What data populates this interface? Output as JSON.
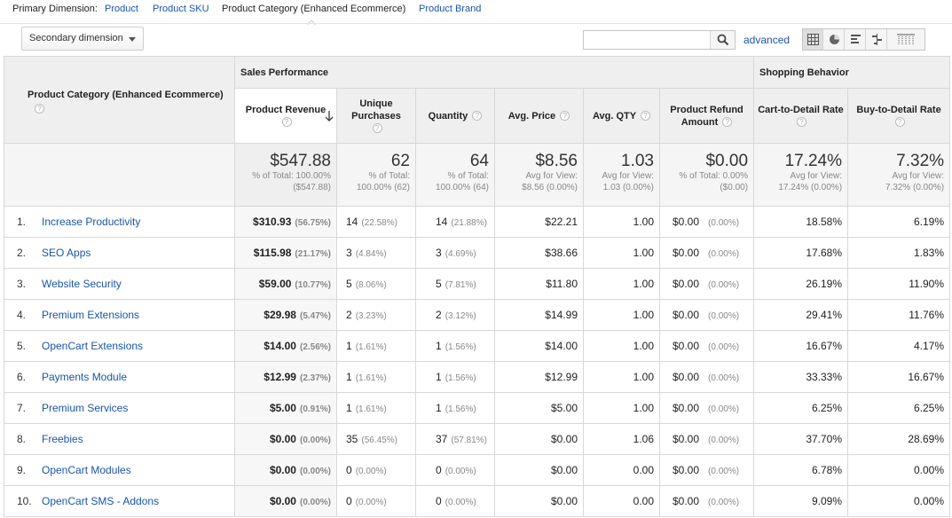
{
  "primary_dimension": {
    "label": "Primary Dimension:",
    "options": [
      "Product",
      "Product SKU",
      "Product Category (Enhanced Ecommerce)",
      "Product Brand"
    ],
    "active_index": 2
  },
  "secondary_dimension": {
    "label": "Secondary dimension"
  },
  "search": {
    "value": "",
    "placeholder": ""
  },
  "advanced_label": "advanced",
  "view_icons": [
    "table-view-icon",
    "pie-view-icon",
    "performance-view-icon",
    "comparison-view-icon",
    "pivot-view-icon"
  ],
  "colors": {
    "link": "#1a55a8",
    "header_bg": "#efefef",
    "border": "#d8d8d8"
  },
  "table": {
    "dimension_header": "Product Category (Enhanced Ecommerce)",
    "groups": {
      "sales": "Sales Performance",
      "shopping": "Shopping Behavior"
    },
    "columns": [
      {
        "label": "Product Revenue",
        "sorted": true
      },
      {
        "label": "Unique Purchases"
      },
      {
        "label": "Quantity"
      },
      {
        "label": "Avg. Price"
      },
      {
        "label": "Avg. QTY"
      },
      {
        "label": "Product Refund Amount"
      },
      {
        "label": "Cart-to-Detail Rate"
      },
      {
        "label": "Buy-to-Detail Rate"
      }
    ],
    "totals": [
      {
        "value": "$547.88",
        "sub1": "% of Total: 100.00%",
        "sub2": "($547.88)"
      },
      {
        "value": "62",
        "sub1": "% of Total:",
        "sub2": "100.00% (62)"
      },
      {
        "value": "64",
        "sub1": "% of Total:",
        "sub2": "100.00% (64)"
      },
      {
        "value": "$8.56",
        "sub1": "Avg for View:",
        "sub2": "$8.56 (0.00%)"
      },
      {
        "value": "1.03",
        "sub1": "Avg for View:",
        "sub2": "1.03 (0.00%)"
      },
      {
        "value": "$0.00",
        "sub1": "% of Total: 0.00%",
        "sub2": "($0.00)"
      },
      {
        "value": "17.24%",
        "sub1": "Avg for View:",
        "sub2": "17.24% (0.00%)"
      },
      {
        "value": "7.32%",
        "sub1": "Avg for View:",
        "sub2": "7.32% (0.00%)"
      }
    ],
    "rows": [
      {
        "idx": "1.",
        "name": "Increase Productivity",
        "revenue": "$310.93",
        "revenue_pct": "(56.75%)",
        "unique": "14",
        "unique_pct": "(22.58%)",
        "qty": "14",
        "qty_pct": "(21.88%)",
        "avg_price": "$22.21",
        "avg_qty": "1.00",
        "refund": "$0.00",
        "refund_pct": "(0.00%)",
        "cart": "18.58%",
        "buy": "6.19%"
      },
      {
        "idx": "2.",
        "name": "SEO Apps",
        "revenue": "$115.98",
        "revenue_pct": "(21.17%)",
        "unique": "3",
        "unique_pct": "(4.84%)",
        "qty": "3",
        "qty_pct": "(4.69%)",
        "avg_price": "$38.66",
        "avg_qty": "1.00",
        "refund": "$0.00",
        "refund_pct": "(0.00%)",
        "cart": "17.68%",
        "buy": "1.83%"
      },
      {
        "idx": "3.",
        "name": "Website Security",
        "revenue": "$59.00",
        "revenue_pct": "(10.77%)",
        "unique": "5",
        "unique_pct": "(8.06%)",
        "qty": "5",
        "qty_pct": "(7.81%)",
        "avg_price": "$11.80",
        "avg_qty": "1.00",
        "refund": "$0.00",
        "refund_pct": "(0.00%)",
        "cart": "26.19%",
        "buy": "11.90%"
      },
      {
        "idx": "4.",
        "name": "Premium Extensions",
        "revenue": "$29.98",
        "revenue_pct": "(5.47%)",
        "unique": "2",
        "unique_pct": "(3.23%)",
        "qty": "2",
        "qty_pct": "(3.12%)",
        "avg_price": "$14.99",
        "avg_qty": "1.00",
        "refund": "$0.00",
        "refund_pct": "(0.00%)",
        "cart": "29.41%",
        "buy": "11.76%"
      },
      {
        "idx": "5.",
        "name": "OpenCart Extensions",
        "revenue": "$14.00",
        "revenue_pct": "(2.56%)",
        "unique": "1",
        "unique_pct": "(1.61%)",
        "qty": "1",
        "qty_pct": "(1.56%)",
        "avg_price": "$14.00",
        "avg_qty": "1.00",
        "refund": "$0.00",
        "refund_pct": "(0.00%)",
        "cart": "16.67%",
        "buy": "4.17%"
      },
      {
        "idx": "6.",
        "name": "Payments Module",
        "revenue": "$12.99",
        "revenue_pct": "(2.37%)",
        "unique": "1",
        "unique_pct": "(1.61%)",
        "qty": "1",
        "qty_pct": "(1.56%)",
        "avg_price": "$12.99",
        "avg_qty": "1.00",
        "refund": "$0.00",
        "refund_pct": "(0.00%)",
        "cart": "33.33%",
        "buy": "16.67%"
      },
      {
        "idx": "7.",
        "name": "Premium Services",
        "revenue": "$5.00",
        "revenue_pct": "(0.91%)",
        "unique": "1",
        "unique_pct": "(1.61%)",
        "qty": "1",
        "qty_pct": "(1.56%)",
        "avg_price": "$5.00",
        "avg_qty": "1.00",
        "refund": "$0.00",
        "refund_pct": "(0.00%)",
        "cart": "6.25%",
        "buy": "6.25%"
      },
      {
        "idx": "8.",
        "name": "Freebies",
        "revenue": "$0.00",
        "revenue_pct": "(0.00%)",
        "unique": "35",
        "unique_pct": "(56.45%)",
        "qty": "37",
        "qty_pct": "(57.81%)",
        "avg_price": "$0.00",
        "avg_qty": "1.06",
        "refund": "$0.00",
        "refund_pct": "(0.00%)",
        "cart": "37.70%",
        "buy": "28.69%"
      },
      {
        "idx": "9.",
        "name": "OpenCart Modules",
        "revenue": "$0.00",
        "revenue_pct": "(0.00%)",
        "unique": "0",
        "unique_pct": "(0.00%)",
        "qty": "0",
        "qty_pct": "(0.00%)",
        "avg_price": "$0.00",
        "avg_qty": "0.00",
        "refund": "$0.00",
        "refund_pct": "(0.00%)",
        "cart": "6.78%",
        "buy": "0.00%"
      },
      {
        "idx": "10.",
        "name": "OpenCart SMS - Addons",
        "revenue": "$0.00",
        "revenue_pct": "(0.00%)",
        "unique": "0",
        "unique_pct": "(0.00%)",
        "qty": "0",
        "qty_pct": "(0.00%)",
        "avg_price": "$0.00",
        "avg_qty": "0.00",
        "refund": "$0.00",
        "refund_pct": "(0.00%)",
        "cart": "9.09%",
        "buy": "0.00%"
      }
    ]
  }
}
